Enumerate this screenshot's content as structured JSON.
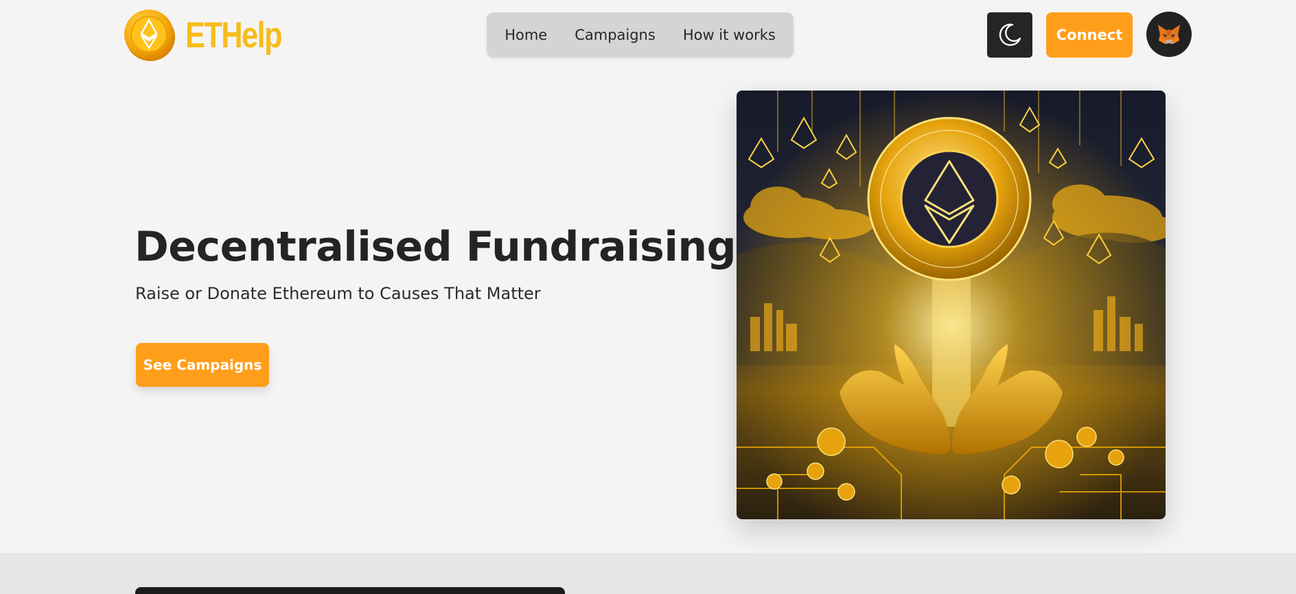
{
  "brand": {
    "name": "ETHelp",
    "logo_icon": "ethereum-coin-icon",
    "color": "#f7bc1b"
  },
  "nav": {
    "items": [
      {
        "label": "Home"
      },
      {
        "label": "Campaigns"
      },
      {
        "label": "How it works"
      }
    ]
  },
  "header": {
    "theme_toggle_icon": "moon-icon",
    "connect_label": "Connect",
    "wallet_icon": "metamask-fox-icon"
  },
  "hero": {
    "title": "Decentralised Fundraising",
    "subtitle": "Raise or Donate Ethereum to Causes That Matter",
    "cta_label": "See Campaigns",
    "image": "golden-ethereum-coin-hands-illustration"
  },
  "colors": {
    "accent": "#ff9e1a",
    "background": "#f4f4f4",
    "nav_bg": "#d4d4d4",
    "dark": "#252525",
    "band_bg": "#e6e6e6"
  }
}
